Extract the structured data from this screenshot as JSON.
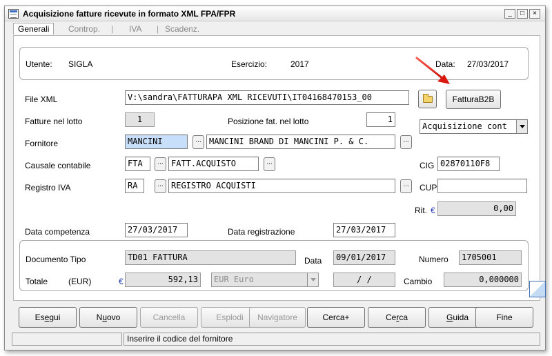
{
  "window": {
    "title": "Acquisizione fatture ricevute in formato XML FPA/FPR",
    "minimize": "_",
    "maximize": "□",
    "close": "×"
  },
  "tabs": [
    {
      "label": "Generali",
      "active": true
    },
    {
      "label": "Controp.",
      "active": false
    },
    {
      "label": "IVA",
      "active": false
    },
    {
      "label": "Scadenz.",
      "active": false
    }
  ],
  "tab_separator": "|",
  "header": {
    "utente_label": "Utente:",
    "utente_value": "SIGLA",
    "esercizio_label": "Esercizio:",
    "esercizio_value": "2017",
    "data_label": "Data:",
    "data_value": "27/03/2017"
  },
  "form": {
    "file_xml_label": "File XML",
    "file_xml_value": "V:\\sandra\\FATTURAPA XML RICEVUTI\\IT04168470153_00",
    "fattura_b2b_button": "FatturaB2B",
    "fatture_lotto_label": "Fatture nel lotto",
    "fatture_lotto_value": "1",
    "posizione_label": "Posizione fat. nel lotto",
    "posizione_value": "1",
    "acquisizione_value": "Acquisizione cont",
    "fornitore_label": "Fornitore",
    "fornitore_code": "MANCINI",
    "fornitore_name": "MANCINI BRAND DI MANCINI P. & C.",
    "causale_label": "Causale contabile",
    "causale_code": "FTA",
    "causale_desc": "FATT.ACQUISTO",
    "cig_label": "CIG",
    "cig_value": "02870110F8",
    "registro_label": "Registro IVA",
    "registro_code": "RA",
    "registro_desc": "REGISTRO ACQUISTI",
    "cup_label": "CUP",
    "cup_value": "",
    "rit_label": "Rit.",
    "rit_value": "0,00",
    "data_competenza_label": "Data competenza",
    "data_competenza_value": "27/03/2017",
    "data_registrazione_label": "Data registrazione",
    "data_registrazione_value": "27/03/2017",
    "lookup_button": "..."
  },
  "documento": {
    "tipo_label": "Documento Tipo",
    "tipo_value": "TD01 FATTURA",
    "data_label": "Data",
    "data_value": "09/01/2017",
    "numero_label": "Numero",
    "numero_value": "1705001",
    "totale_label": "Totale",
    "eur_label": "(EUR)",
    "totale_value": "592,13",
    "valuta_value": "EUR Euro",
    "data_cambio_value": "/   /",
    "cambio_label": "Cambio",
    "cambio_value": "0,000000"
  },
  "currency_symbol": "€",
  "buttons": [
    {
      "pre": "Es",
      "key": "e",
      "post": "gui",
      "disabled": false,
      "name": "esegui-button"
    },
    {
      "pre": "N",
      "key": "u",
      "post": "ovo",
      "disabled": false,
      "name": "nuovo-button"
    },
    {
      "pre": "",
      "key": "",
      "post": "Cancella",
      "disabled": true,
      "name": "cancella-button"
    },
    {
      "pre": "",
      "key": "",
      "post": "Esplodi",
      "disabled": true,
      "name": "esplodi-button"
    },
    {
      "pre": "",
      "key": "",
      "post": "Navigatore",
      "disabled": true,
      "name": "navigatore-button"
    },
    {
      "pre": "Cerca+",
      "key": "",
      "post": "",
      "disabled": false,
      "name": "cerca-plus-button"
    },
    {
      "pre": "Ce",
      "key": "r",
      "post": "ca",
      "disabled": false,
      "name": "cerca-button"
    },
    {
      "pre": "",
      "key": "G",
      "post": "uida",
      "disabled": false,
      "name": "guida-button"
    },
    {
      "pre": "Fine",
      "key": "",
      "post": "",
      "disabled": false,
      "name": "fine-button"
    }
  ],
  "status": {
    "left": "",
    "message": "Inserire il codice del fornitore"
  },
  "colors": {
    "selection": "#c7dffa",
    "arrow": "#e0201a",
    "euro": "#1f3fb0"
  }
}
